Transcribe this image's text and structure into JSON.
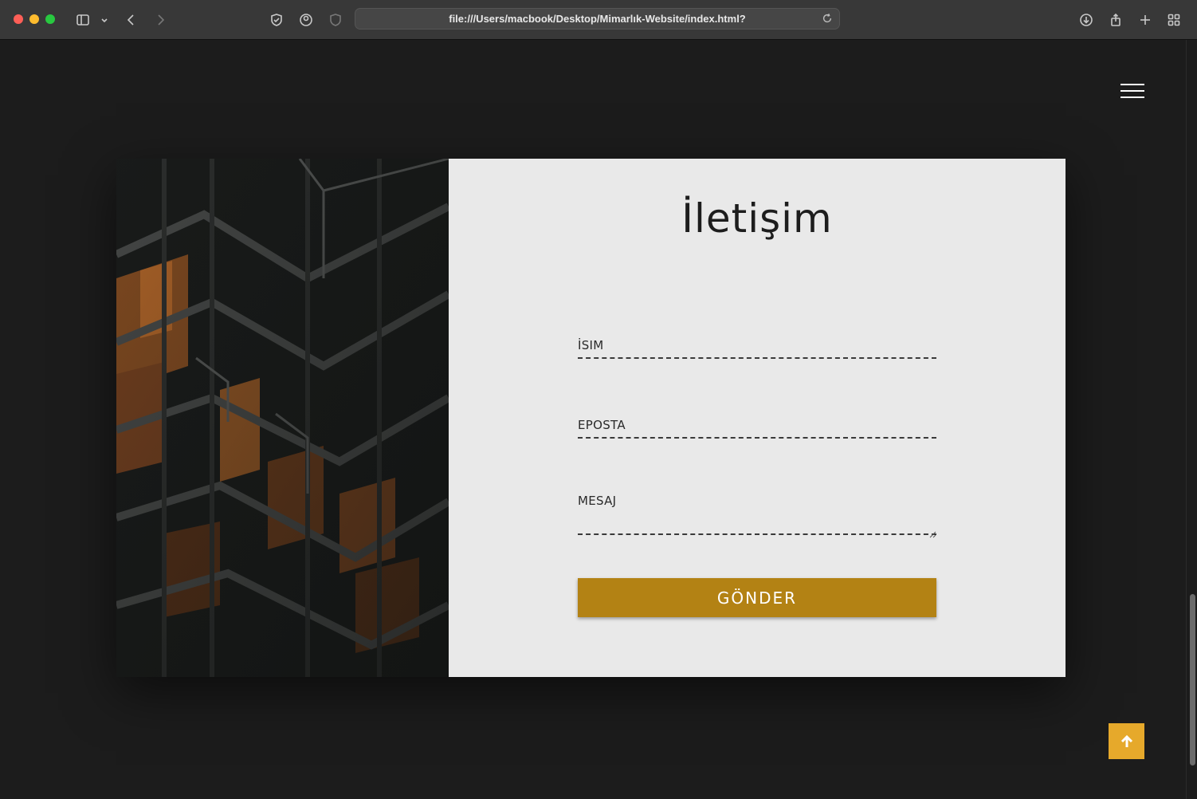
{
  "browser": {
    "url": "file:///Users/macbook/Desktop/Mimarlık-Website/index.html?"
  },
  "contact": {
    "title": "İletişim",
    "fields": {
      "name_label": "İSIM",
      "email_label": "EPOSTA",
      "message_label": "MESAJ"
    },
    "submit_label": "GÖNDER"
  },
  "colors": {
    "accent": "#b38214",
    "to_top": "#e6a92b",
    "panel": "#e9e9e9",
    "background": "#1c1c1c"
  },
  "icons": {
    "menu": "hamburger-menu-icon",
    "scroll_top": "arrow-up-icon"
  }
}
